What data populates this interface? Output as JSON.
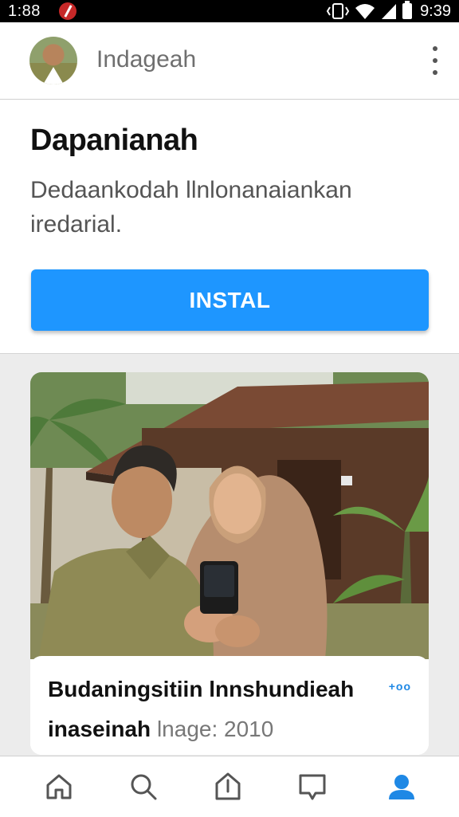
{
  "status_bar": {
    "time": "1:88",
    "clock": "9:39",
    "icons": [
      "notification-icon",
      "vibrate-icon",
      "wifi-icon",
      "signal-icon",
      "battery-icon"
    ]
  },
  "app_bar": {
    "title": "Indageah",
    "menu_icon": "more-vert-icon"
  },
  "install_section": {
    "heading": "Dapanianah",
    "description": "Dedaankodah llnlonanaiankan iredarial.",
    "button_label": "INSTAL"
  },
  "card": {
    "title": "Budaningsitiin lnnshundieah",
    "subtitle": "inaseinah",
    "meta": "lnage: 2010",
    "badge": "+oo"
  },
  "bottom_nav": {
    "items": [
      "home-icon",
      "search-icon",
      "upload-icon",
      "message-icon",
      "profile-icon"
    ],
    "active_index": 4,
    "active_color": "#1e88e5"
  },
  "colors": {
    "accent": "#1e96ff",
    "status_bar": "#000000"
  }
}
